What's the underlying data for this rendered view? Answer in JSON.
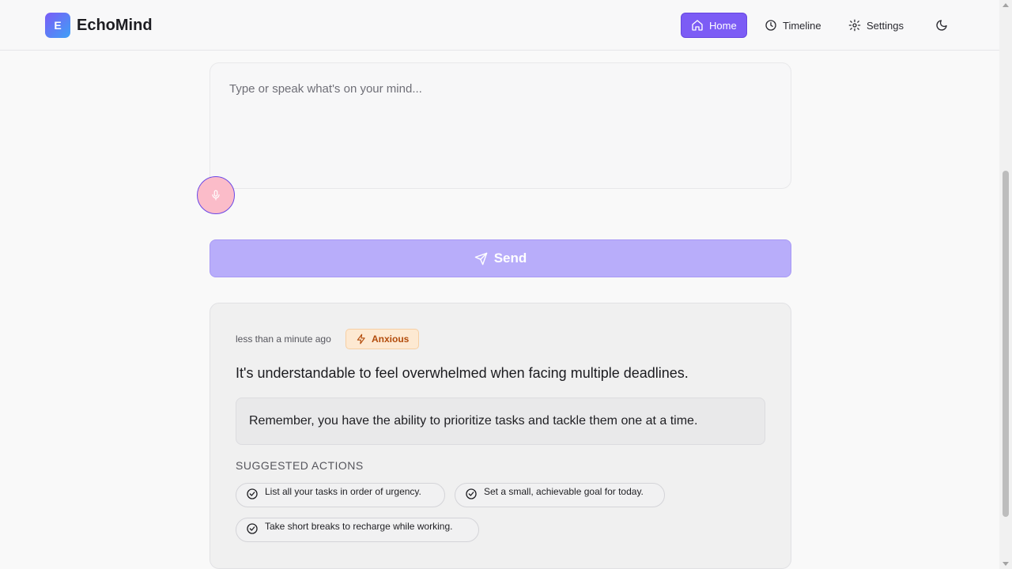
{
  "app": {
    "logo_letter": "E",
    "name": "EchoMind"
  },
  "nav": {
    "home": "Home",
    "timeline": "Timeline",
    "settings": "Settings"
  },
  "composer": {
    "placeholder": "Type or speak what's on your mind...",
    "value": "",
    "send_label": "Send"
  },
  "entry": {
    "time": "less than a minute ago",
    "mood": "Anxious",
    "headline": "It's understandable to feel overwhelmed when facing multiple deadlines.",
    "affirmation": "Remember, you have the ability to prioritize tasks and tackle them one at a time.",
    "actions_title": "SUGGESTED ACTIONS",
    "actions": [
      "List all your tasks in order of urgency.",
      "Set a small, achievable goal for today.",
      "Take short breaks to recharge while working."
    ]
  },
  "colors": {
    "primary": "#7c5cf5",
    "send_disabled": "#b8adfa",
    "mic_bg": "#fbbcc9",
    "mood_bg": "#fde9d2",
    "mood_text": "#b24b0b"
  }
}
